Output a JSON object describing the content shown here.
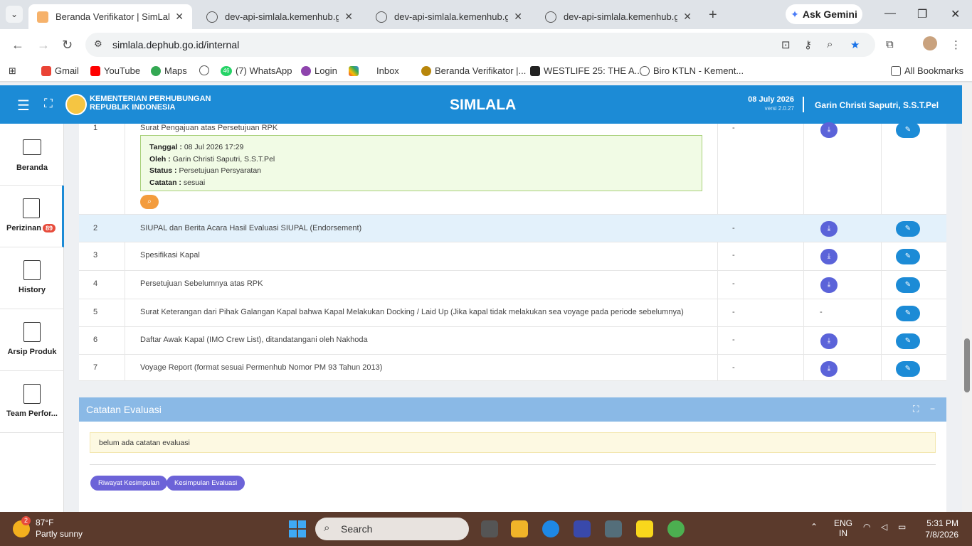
{
  "browser": {
    "tabs": [
      {
        "label": "Beranda Verifikator | SimLala",
        "active": true
      },
      {
        "label": "dev-api-simlala.kemenhub.go.id",
        "active": false
      },
      {
        "label": "dev-api-simlala.kemenhub.go.id",
        "active": false
      },
      {
        "label": "dev-api-simlala.kemenhub.go.id",
        "active": false
      }
    ],
    "ask_gemini": "Ask Gemini",
    "url": "simlala.dephub.go.id/internal",
    "bookmarks": [
      "Gmail",
      "YouTube",
      "Maps",
      "(7) WhatsApp",
      "Login",
      "Inbox",
      "Beranda Verifikator |...",
      "WESTLIFE 25: THE A...",
      "Biro KTLN - Kement..."
    ],
    "bookmark_count_badge": "46",
    "all_bookmarks": "All Bookmarks"
  },
  "header": {
    "org_line1": "KEMENTERIAN PERHUBUNGAN",
    "org_line2": "REPUBLIK INDONESIA",
    "brand": "SIMLALA",
    "date": "08 July 2026",
    "version": "versi 2.0.27",
    "user": "Garin Christi Saputri, S.S.T.Pel"
  },
  "sidebar": {
    "items": [
      {
        "label": "Beranda"
      },
      {
        "label": "Perizinan",
        "badge": "89"
      },
      {
        "label": "History"
      },
      {
        "label": "Arsip Produk"
      },
      {
        "label": "Team Perfor..."
      }
    ]
  },
  "documents": {
    "rows": [
      {
        "no": "1",
        "name": "Surat Pengajuan atas Persetujuan RPK",
        "col3": "-"
      },
      {
        "no": "2",
        "name": "SIUPAL dan Berita Acara Hasil Evaluasi SIUPAL (Endorsement)",
        "col3": "-"
      },
      {
        "no": "3",
        "name": "Spesifikasi Kapal",
        "col3": "-"
      },
      {
        "no": "4",
        "name": "Persetujuan Sebelumnya atas RPK",
        "col3": "-"
      },
      {
        "no": "5",
        "name": "Surat Keterangan dari Pihak Galangan Kapal bahwa Kapal Melakukan Docking / Laid Up (Jika kapal tidak melakukan sea voyage pada periode sebelumnya)",
        "col3": "-",
        "col4": "-"
      },
      {
        "no": "6",
        "name": "Daftar Awak Kapal (IMO Crew List), ditandatangani oleh Nakhoda",
        "col3": "-"
      },
      {
        "no": "7",
        "name": "Voyage Report (format sesuai Permenhub Nomor PM 93 Tahun 2013)",
        "col3": "-"
      }
    ],
    "info": {
      "tanggal_label": "Tanggal :",
      "tanggal": "08 Jul 2026 17:29",
      "oleh_label": "Oleh :",
      "oleh": "Garin Christi Saputri, S.S.T.Pel",
      "status_label": "Status :",
      "status": "Persetujuan Persyaratan",
      "catatan_label": "Catatan :",
      "catatan": "sesuai"
    }
  },
  "evaluasi": {
    "title": "Catatan Evaluasi",
    "note": "belum ada catatan evaluasi",
    "btn_riwayat": "Riwayat Kesimpulan",
    "btn_kesimpulan": "Kesimpulan Evaluasi"
  },
  "taskbar": {
    "weather_badge": "2",
    "temp": "87°F",
    "condition": "Partly sunny",
    "search": "Search",
    "lang1": "ENG",
    "lang2": "IN",
    "time": "5:31 PM",
    "date": "7/8/2026"
  },
  "colors": {
    "primary": "#1c8bd6",
    "download": "#5b63d9",
    "accent": "#f39c3d",
    "card_header": "#8ab9e6"
  }
}
